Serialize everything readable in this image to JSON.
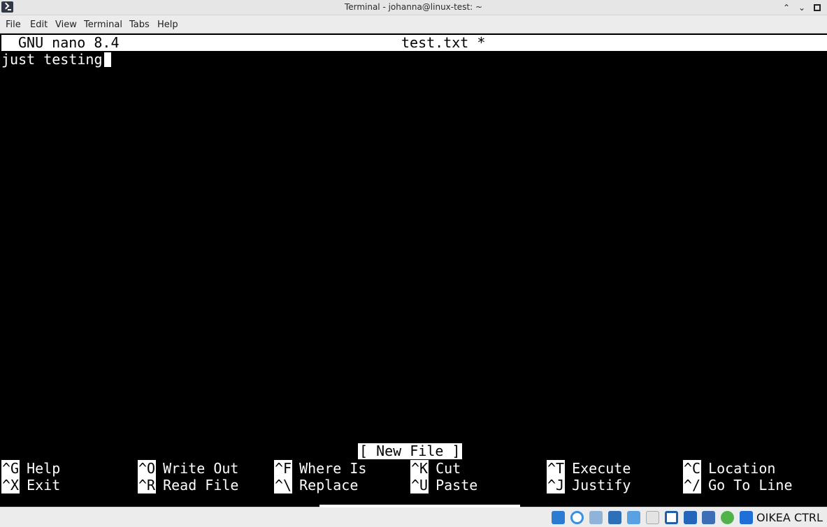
{
  "window": {
    "title": "Terminal - johanna@linux-test: ~"
  },
  "menu": [
    "File",
    "Edit",
    "View",
    "Terminal",
    "Tabs",
    "Help"
  ],
  "nano": {
    "version_label": "GNU nano 8.4",
    "filename_label": "test.txt *",
    "content_line": "just testing",
    "status_message": "[ New File ]",
    "shortcuts_row1": [
      {
        "key": "^G",
        "label": "Help"
      },
      {
        "key": "^O",
        "label": "Write Out"
      },
      {
        "key": "^F",
        "label": "Where Is"
      },
      {
        "key": "^K",
        "label": "Cut"
      },
      {
        "key": "^T",
        "label": "Execute"
      },
      {
        "key": "^C",
        "label": "Location"
      }
    ],
    "shortcuts_row2": [
      {
        "key": "^X",
        "label": "Exit"
      },
      {
        "key": "^R",
        "label": "Read File"
      },
      {
        "key": "^\\",
        "label": "Replace"
      },
      {
        "key": "^U",
        "label": "Paste"
      },
      {
        "key": "^J",
        "label": "Justify"
      },
      {
        "key": "^/",
        "label": "Go To Line"
      }
    ]
  },
  "taskbar": {
    "tray_label": "OIKEA CTRL",
    "tray_icons": [
      "virtualbox-audio-icon",
      "optical-drive-icon",
      "usb-icon",
      "shared-folders-icon",
      "network-icon",
      "display-icon",
      "screen-icon",
      "recording-icon",
      "virtualbox-icon",
      "mouse-integration-icon",
      "download-icon"
    ]
  }
}
